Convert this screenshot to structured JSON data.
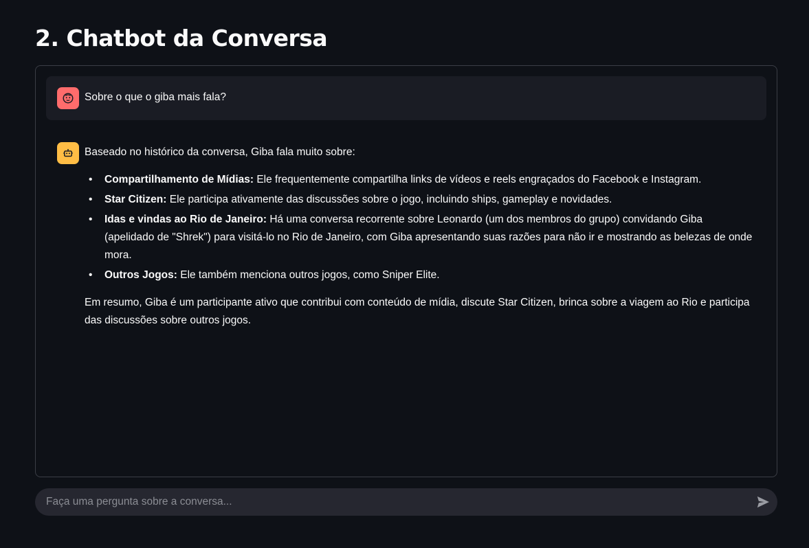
{
  "page": {
    "title": "2. Chatbot da Conversa"
  },
  "chat": {
    "user_message": "Sobre o que o giba mais fala?",
    "bot_intro": "Baseado no histórico da conversa, Giba fala muito sobre:",
    "bot_items": [
      {
        "bold": "Compartilhamento de Mídias:",
        "text": " Ele frequentemente compartilha links de vídeos e reels engraçados do Facebook e Instagram."
      },
      {
        "bold": "Star Citizen:",
        "text": " Ele participa ativamente das discussões sobre o jogo, incluindo ships, gameplay e novidades."
      },
      {
        "bold": "Idas e vindas ao Rio de Janeiro:",
        "text": " Há uma conversa recorrente sobre Leonardo (um dos membros do grupo) convidando Giba (apelidado de \"Shrek\") para visitá-lo no Rio de Janeiro, com Giba apresentando suas razões para não ir e mostrando as belezas de onde mora."
      },
      {
        "bold": "Outros Jogos:",
        "text": " Ele também menciona outros jogos, como Sniper Elite."
      }
    ],
    "bot_summary": "Em resumo, Giba é um participante ativo que contribui com conteúdo de mídia, discute Star Citizen, brinca sobre a viagem ao Rio e participa das discussões sobre outros jogos."
  },
  "input": {
    "placeholder": "Faça uma pergunta sobre a conversa...",
    "value": ""
  },
  "icons": {
    "user_avatar": "face-icon",
    "bot_avatar": "robot-icon",
    "send": "send-icon"
  },
  "colors": {
    "background": "#0e1117",
    "user_avatar": "#ff6c6c",
    "bot_avatar": "#ffbd45",
    "user_message_bg": "#1a1c24",
    "input_bg": "#262730"
  }
}
